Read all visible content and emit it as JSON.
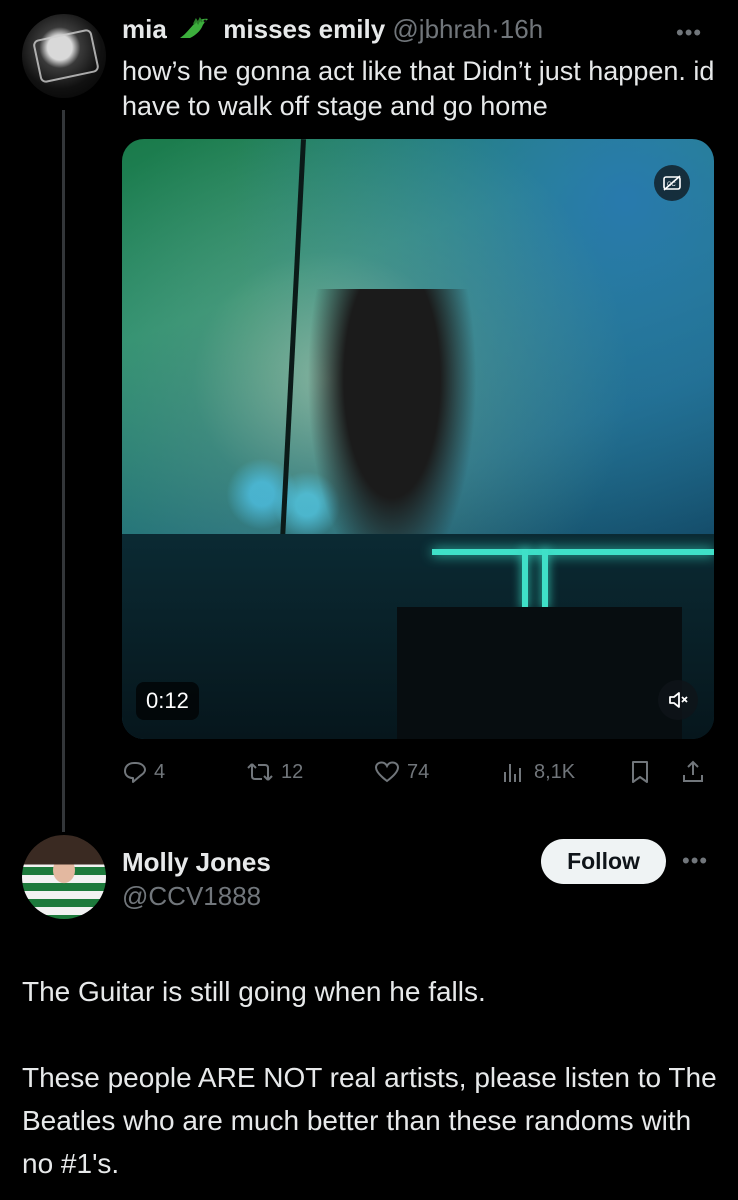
{
  "tweet1": {
    "display_name": "mia",
    "display_name_suffix": "misses emily",
    "emoji_icon": "crocodile-emoji-icon",
    "handle": "@jbhrah",
    "separator": "·",
    "time": "16h",
    "more_icon": "•••",
    "text": "how’s he gonna act like that Didn’t just happen. id have to walk off stage and go home",
    "video": {
      "duration_badge": "0:12",
      "cc_icon": "captions-off-icon",
      "mute_icon": "speaker-muted-icon"
    },
    "actions": {
      "replies": "4",
      "reposts": "12",
      "likes": "74",
      "views": "8,1K"
    }
  },
  "tweet2": {
    "display_name": "Molly Jones",
    "handle": "@CCV1888",
    "follow_label": "Follow",
    "more_icon": "•••",
    "text_p1": "The Guitar is still going when he falls.",
    "text_p2": "These people ARE NOT real artists, please listen to The Beatles who are much better than these randoms with no #1's."
  },
  "colors": {
    "background": "#000000",
    "primary_text": "#e7e9ea",
    "secondary_text": "#71767b",
    "follow_button_bg": "#eff3f4"
  }
}
